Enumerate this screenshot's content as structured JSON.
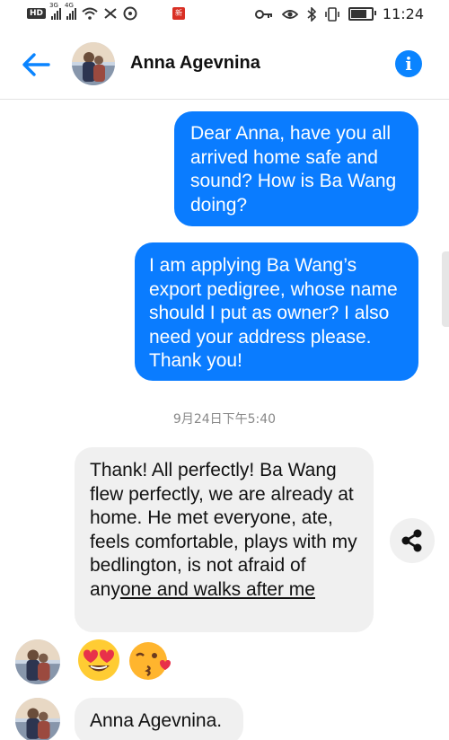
{
  "status_bar": {
    "hd": "HD",
    "sim1_gen": "3G",
    "sim2_gen": "4G",
    "app_badge": "新",
    "time": "11:24"
  },
  "header": {
    "contact_name": "Anna Agevnina",
    "back_icon": "arrow-left-icon",
    "info_icon": "info-icon",
    "info_glyph": "i"
  },
  "messages": [
    {
      "direction": "outgoing",
      "text": "Dear Anna, have you all arrived home safe and sound? How is Ba Wang doing?"
    },
    {
      "direction": "outgoing",
      "text": "I am applying Ba Wang’s export pedigree,  whose name should I put as owner? I also need your address please. Thank you!"
    },
    {
      "direction": "incoming",
      "text_before_link": "Thank! All perfectly! Ba Wang flew perfectly, we are already at home. He met everyone, ate, feels comfortable, plays with my bedlington, is not afraid of any",
      "text_underlined": "one and walks after me"
    },
    {
      "direction": "incoming",
      "text": "Anna Agevnina."
    }
  ],
  "timestamp": "9月24日下午5:40",
  "emojis": [
    "heart-eyes-emoji",
    "kissing-heart-emoji"
  ],
  "colors": {
    "accent": "#0a84ff",
    "outgoing_bubble": "#0a7cff",
    "incoming_bubble": "#f0f0f0"
  }
}
